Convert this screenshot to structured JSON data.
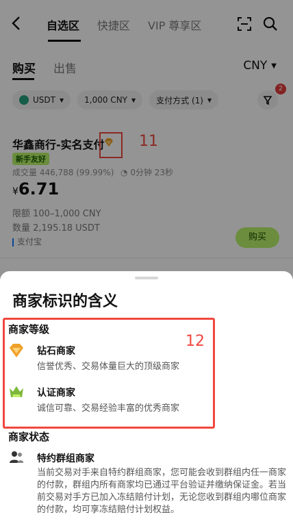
{
  "nav": {
    "back_icon": "chevron-left-icon",
    "tabs": [
      "自选区",
      "快捷区",
      "VIP 尊享区"
    ],
    "scan_icon": "scan-icon",
    "search_icon": "search-icon"
  },
  "trade": {
    "buy_label": "购买",
    "sell_label": "出售",
    "currency": "CNY"
  },
  "filters": {
    "coin": "USDT",
    "amount": "1,000 CNY",
    "payment": "支付方式 (1)",
    "filter_badge": "2"
  },
  "listing": {
    "merchant_name": "华鑫商行-实名支付",
    "annotation_11": "11",
    "new_badge": "新手友好",
    "volume": "成交量 446,788 (99.99%)",
    "timer": "0分钟 23秒",
    "currency_symbol": "¥",
    "price": "6.71",
    "limit": "限额 100–1,000 CNY",
    "quantity": "数量 2,195.18 USDT",
    "pay_method": "支付宝",
    "buy_button": "购买"
  },
  "sheet": {
    "title": "商家标识的含义",
    "annotation_12": "12",
    "level_heading": "商家等级",
    "diamond": {
      "name": "钻石商家",
      "desc": "信誉优秀、交易体量巨大的顶级商家"
    },
    "certified": {
      "name": "认证商家",
      "desc": "诚信可靠、交易经验丰富的优秀商家"
    },
    "status_heading": "商家状态",
    "group": {
      "name": "特约群组商家",
      "desc": "当前交易对手来自特约群组商家，您可能会收到群组内任一商家的付款，群组内所有商家均已通过平台验证并缴纳保证金。若当前交易对手方已加入冻结赔付计划，无论您收到群组内哪位商家的付款，均可享冻结赔付计划权益。"
    }
  },
  "colors": {
    "accent_green": "#b9f36a",
    "annotation_red": "#f0473f",
    "diamond_orange": "#f0a12a"
  }
}
